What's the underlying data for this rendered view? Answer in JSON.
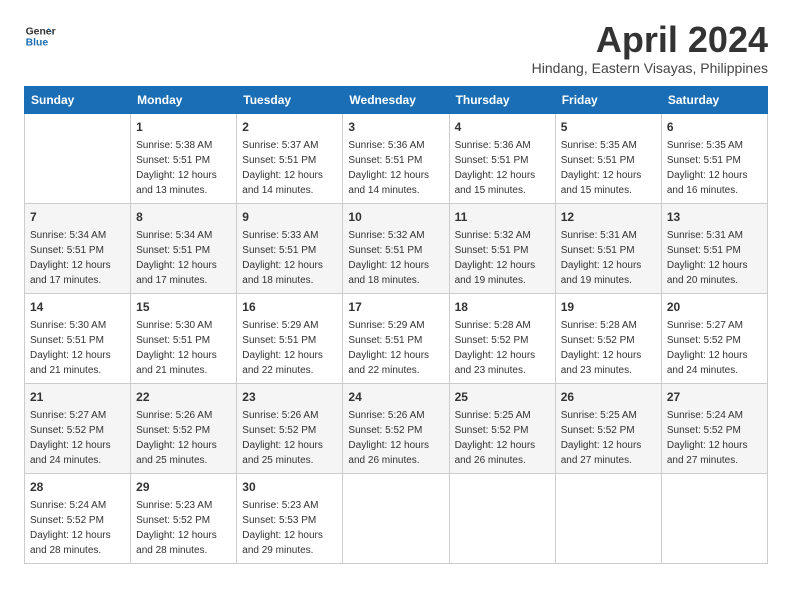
{
  "header": {
    "logo_line1": "General",
    "logo_line2": "Blue",
    "month_title": "April 2024",
    "subtitle": "Hindang, Eastern Visayas, Philippines"
  },
  "days_of_week": [
    "Sunday",
    "Monday",
    "Tuesday",
    "Wednesday",
    "Thursday",
    "Friday",
    "Saturday"
  ],
  "weeks": [
    [
      {
        "day": "",
        "info": ""
      },
      {
        "day": "1",
        "info": "Sunrise: 5:38 AM\nSunset: 5:51 PM\nDaylight: 12 hours\nand 13 minutes."
      },
      {
        "day": "2",
        "info": "Sunrise: 5:37 AM\nSunset: 5:51 PM\nDaylight: 12 hours\nand 14 minutes."
      },
      {
        "day": "3",
        "info": "Sunrise: 5:36 AM\nSunset: 5:51 PM\nDaylight: 12 hours\nand 14 minutes."
      },
      {
        "day": "4",
        "info": "Sunrise: 5:36 AM\nSunset: 5:51 PM\nDaylight: 12 hours\nand 15 minutes."
      },
      {
        "day": "5",
        "info": "Sunrise: 5:35 AM\nSunset: 5:51 PM\nDaylight: 12 hours\nand 15 minutes."
      },
      {
        "day": "6",
        "info": "Sunrise: 5:35 AM\nSunset: 5:51 PM\nDaylight: 12 hours\nand 16 minutes."
      }
    ],
    [
      {
        "day": "7",
        "info": "Sunrise: 5:34 AM\nSunset: 5:51 PM\nDaylight: 12 hours\nand 17 minutes."
      },
      {
        "day": "8",
        "info": "Sunrise: 5:34 AM\nSunset: 5:51 PM\nDaylight: 12 hours\nand 17 minutes."
      },
      {
        "day": "9",
        "info": "Sunrise: 5:33 AM\nSunset: 5:51 PM\nDaylight: 12 hours\nand 18 minutes."
      },
      {
        "day": "10",
        "info": "Sunrise: 5:32 AM\nSunset: 5:51 PM\nDaylight: 12 hours\nand 18 minutes."
      },
      {
        "day": "11",
        "info": "Sunrise: 5:32 AM\nSunset: 5:51 PM\nDaylight: 12 hours\nand 19 minutes."
      },
      {
        "day": "12",
        "info": "Sunrise: 5:31 AM\nSunset: 5:51 PM\nDaylight: 12 hours\nand 19 minutes."
      },
      {
        "day": "13",
        "info": "Sunrise: 5:31 AM\nSunset: 5:51 PM\nDaylight: 12 hours\nand 20 minutes."
      }
    ],
    [
      {
        "day": "14",
        "info": "Sunrise: 5:30 AM\nSunset: 5:51 PM\nDaylight: 12 hours\nand 21 minutes."
      },
      {
        "day": "15",
        "info": "Sunrise: 5:30 AM\nSunset: 5:51 PM\nDaylight: 12 hours\nand 21 minutes."
      },
      {
        "day": "16",
        "info": "Sunrise: 5:29 AM\nSunset: 5:51 PM\nDaylight: 12 hours\nand 22 minutes."
      },
      {
        "day": "17",
        "info": "Sunrise: 5:29 AM\nSunset: 5:51 PM\nDaylight: 12 hours\nand 22 minutes."
      },
      {
        "day": "18",
        "info": "Sunrise: 5:28 AM\nSunset: 5:52 PM\nDaylight: 12 hours\nand 23 minutes."
      },
      {
        "day": "19",
        "info": "Sunrise: 5:28 AM\nSunset: 5:52 PM\nDaylight: 12 hours\nand 23 minutes."
      },
      {
        "day": "20",
        "info": "Sunrise: 5:27 AM\nSunset: 5:52 PM\nDaylight: 12 hours\nand 24 minutes."
      }
    ],
    [
      {
        "day": "21",
        "info": "Sunrise: 5:27 AM\nSunset: 5:52 PM\nDaylight: 12 hours\nand 24 minutes."
      },
      {
        "day": "22",
        "info": "Sunrise: 5:26 AM\nSunset: 5:52 PM\nDaylight: 12 hours\nand 25 minutes."
      },
      {
        "day": "23",
        "info": "Sunrise: 5:26 AM\nSunset: 5:52 PM\nDaylight: 12 hours\nand 25 minutes."
      },
      {
        "day": "24",
        "info": "Sunrise: 5:26 AM\nSunset: 5:52 PM\nDaylight: 12 hours\nand 26 minutes."
      },
      {
        "day": "25",
        "info": "Sunrise: 5:25 AM\nSunset: 5:52 PM\nDaylight: 12 hours\nand 26 minutes."
      },
      {
        "day": "26",
        "info": "Sunrise: 5:25 AM\nSunset: 5:52 PM\nDaylight: 12 hours\nand 27 minutes."
      },
      {
        "day": "27",
        "info": "Sunrise: 5:24 AM\nSunset: 5:52 PM\nDaylight: 12 hours\nand 27 minutes."
      }
    ],
    [
      {
        "day": "28",
        "info": "Sunrise: 5:24 AM\nSunset: 5:52 PM\nDaylight: 12 hours\nand 28 minutes."
      },
      {
        "day": "29",
        "info": "Sunrise: 5:23 AM\nSunset: 5:52 PM\nDaylight: 12 hours\nand 28 minutes."
      },
      {
        "day": "30",
        "info": "Sunrise: 5:23 AM\nSunset: 5:53 PM\nDaylight: 12 hours\nand 29 minutes."
      },
      {
        "day": "",
        "info": ""
      },
      {
        "day": "",
        "info": ""
      },
      {
        "day": "",
        "info": ""
      },
      {
        "day": "",
        "info": ""
      }
    ]
  ]
}
